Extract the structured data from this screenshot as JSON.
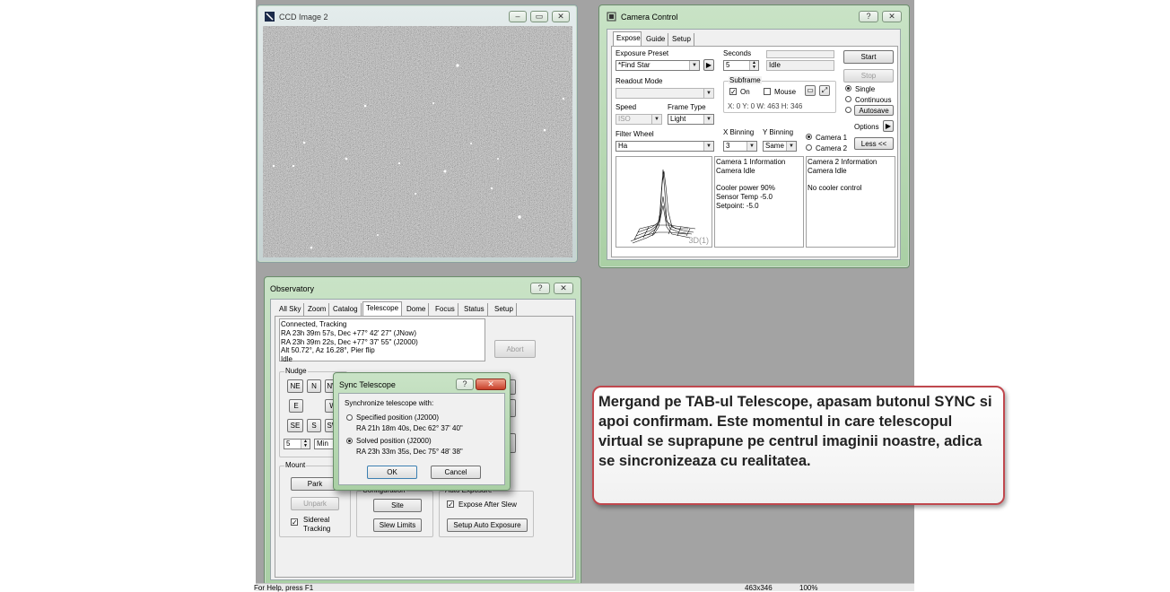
{
  "ccd_window": {
    "title": "CCD Image 2"
  },
  "camera_control": {
    "title": "Camera Control",
    "help": "?",
    "close": "✕",
    "tabs": [
      "Expose",
      "Guide",
      "Setup"
    ],
    "exposure_preset_label": "Exposure Preset",
    "exposure_preset_value": "*Find Star",
    "seconds_label": "Seconds",
    "seconds_value": "5",
    "status_value": "Idle",
    "start": "Start",
    "stop": "Stop",
    "readout_mode_label": "Readout Mode",
    "subframe_label": "Subframe",
    "subframe_on": "On",
    "subframe_mouse": "Mouse",
    "subframe_info": "X:   0 Y:   0 W: 463 H: 346",
    "speed_label": "Speed",
    "speed_value": "ISO",
    "frame_type_label": "Frame Type",
    "frame_type_value": "Light",
    "single": "Single",
    "continuous": "Continuous",
    "autosave": "Autosave",
    "filter_wheel_label": "Filter Wheel",
    "filter_wheel_value": "Ha",
    "x_binning_label": "X Binning",
    "x_binning_value": "3",
    "y_binning_label": "Y Binning",
    "y_binning_value": "Same",
    "options": "Options",
    "camera1": "Camera 1",
    "camera2": "Camera 2",
    "less": "Less <<",
    "plot_label": "3D(1)",
    "camera1_info": "Camera 1 Information\nCamera Idle\n\nCooler power 90%\nSensor Temp -5.0\nSetpoint: -5.0",
    "camera2_info": "Camera 2 Information\nCamera Idle\n\nNo cooler control"
  },
  "observatory": {
    "title": "Observatory",
    "help": "?",
    "close": "✕",
    "tabs": [
      "All Sky",
      "Zoom",
      "Catalog",
      "Telescope",
      "Dome",
      "Focus",
      "Status",
      "Setup"
    ],
    "status_text": "Connected, Tracking\nRA 23h 39m 57s, Dec +77° 42' 27\" (JNow)\nRA 23h 39m 22s, Dec +77° 37' 55\" (J2000)\nAlt 50.72°, Az 16.28°, Pier flip\nIdle",
    "abort": "Abort",
    "nudge_label": "Nudge",
    "nudge": [
      "NE",
      "N",
      "NW",
      "E",
      "W",
      "SE",
      "S",
      "SW"
    ],
    "nudge_amount": "5",
    "nudge_unit": "Min",
    "mount_label": "Mount",
    "park": "Park",
    "unpark": "Unpark",
    "sidereal": "Sidereal\nTracking",
    "configuration_label": "Configuration",
    "site": "Site",
    "slew_limits": "Slew Limits",
    "auto_exposure_label": "Auto Exposure",
    "expose_after_slew": "Expose After Slew",
    "setup_auto_exposure": "Setup Auto Exposure"
  },
  "sync_dialog": {
    "title": "Sync Telescope",
    "help": "?",
    "close": "✕",
    "prompt": "Synchronize telescope with:",
    "specified_label": "Specified position (J2000)",
    "specified_coords": "RA 21h 18m 40s, Dec 62° 37' 40\"",
    "solved_label": "Solved position (J2000)",
    "solved_coords": "RA 23h 33m 35s, Dec 75° 48' 38\"",
    "ok": "OK",
    "cancel": "Cancel"
  },
  "callout": {
    "text": "Mergand pe TAB-ul Telescope, apasam butonul SYNC si apoi confirmam. Este momentul in care telescopul virtual se suprapune pe centrul imaginii noastre, adica se sincronizeaza cu realitatea."
  },
  "statusbar": {
    "help": "For Help, press F1",
    "size": "463x346",
    "zoom": "100%"
  }
}
